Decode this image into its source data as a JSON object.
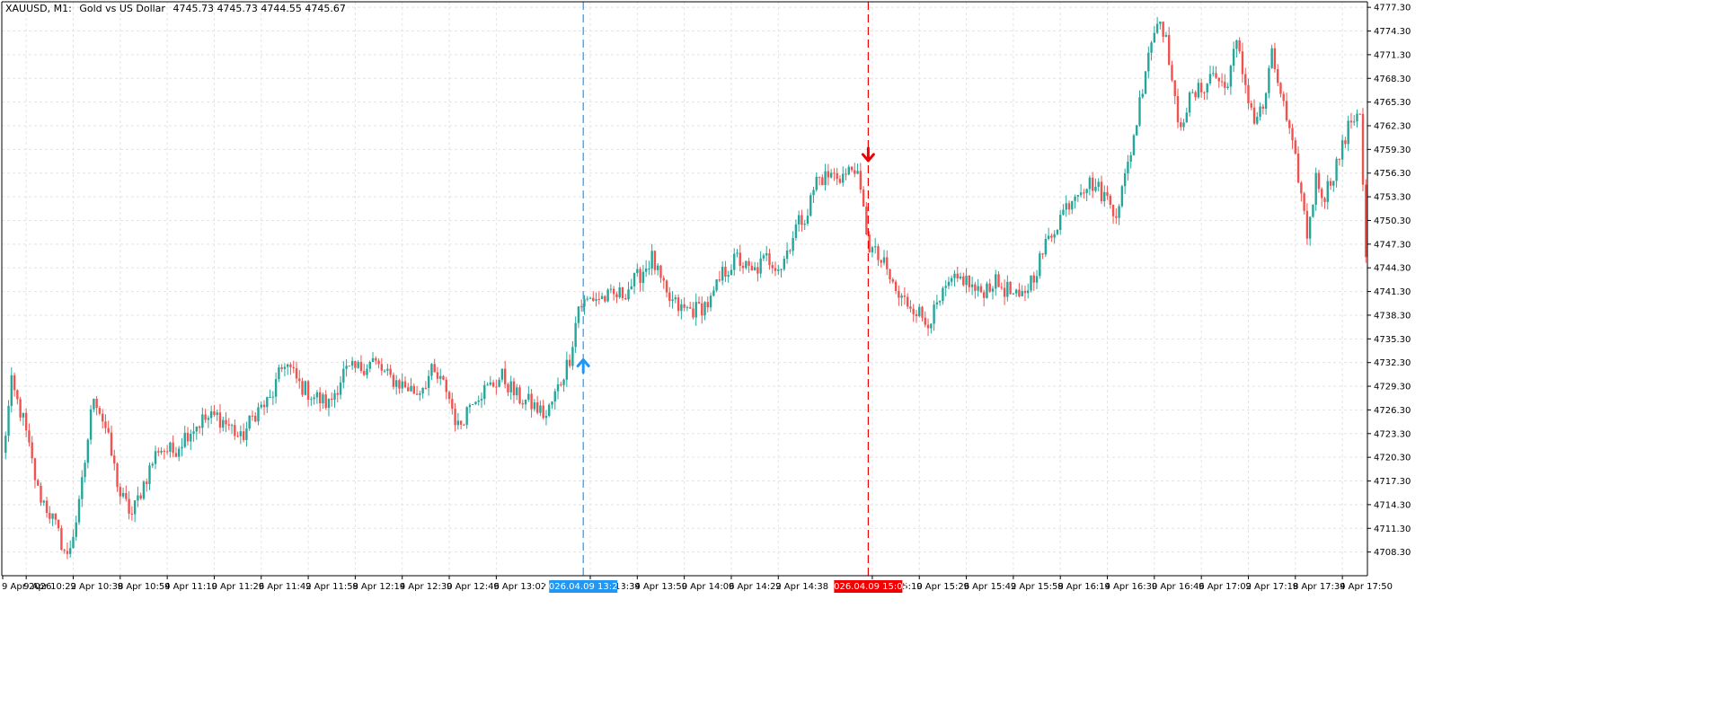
{
  "header": {
    "symbol": "XAUUSD, M1:",
    "description": "Gold vs US Dollar",
    "ohlc": "4745.73 4745.73 4744.55 4745.67"
  },
  "colors": {
    "bull": "#26a69a",
    "bear": "#ef5350",
    "grid": "#e4e4e4",
    "buy_marker": "#2196f3",
    "sell_marker": "#f00000",
    "axis": "#000000"
  },
  "chart_data": {
    "type": "candlestick",
    "timeframe": "M1",
    "ylim": [
      4705.3,
      4778.0
    ],
    "grid": true,
    "y_ticks": [
      "4777.30",
      "4774.30",
      "4771.30",
      "4768.30",
      "4765.30",
      "4762.30",
      "4759.30",
      "4756.30",
      "4753.30",
      "4750.30",
      "4747.30",
      "4744.30",
      "4741.30",
      "4738.30",
      "4735.30",
      "4732.30",
      "4729.30",
      "4726.30",
      "4723.30",
      "4720.30",
      "4717.30",
      "4714.30",
      "4711.30",
      "4708.30"
    ],
    "x_ticks": [
      "9 Apr 2026",
      "9 Apr 10:22",
      "9 Apr 10:38",
      "9 Apr 10:54",
      "9 Apr 11:10",
      "9 Apr 11:26",
      "9 Apr 11:42",
      "9 Apr 11:58",
      "9 Apr 12:14",
      "9 Apr 12:30",
      "9 Apr 12:46",
      "9 Apr 13:02",
      "9 Apr 13:34",
      "9 Apr 13:50",
      "9 Apr 14:06",
      "9 Apr 14:22",
      "9 Apr 14:38",
      "9 Apr 15:10",
      "9 Apr 15:26",
      "9 Apr 15:42",
      "9 Apr 15:58",
      "9 Apr 16:14",
      "9 Apr 16:30",
      "9 Apr 16:46",
      "9 Apr 17:02",
      "9 Apr 17:18",
      "9 Apr 17:34",
      "9 Apr 17:50"
    ],
    "price_path": [
      [
        0,
        4720.5
      ],
      [
        3,
        4729.5
      ],
      [
        7,
        4725.0
      ],
      [
        12,
        4716.0
      ],
      [
        17,
        4712.5
      ],
      [
        22,
        4707.5
      ],
      [
        26,
        4714.0
      ],
      [
        31,
        4728.5
      ],
      [
        35,
        4724.0
      ],
      [
        40,
        4715.5
      ],
      [
        44,
        4713.0
      ],
      [
        48,
        4717.0
      ],
      [
        53,
        4721.5
      ],
      [
        58,
        4721.0
      ],
      [
        63,
        4723.5
      ],
      [
        68,
        4725.0
      ],
      [
        73,
        4725.5
      ],
      [
        78,
        4724.0
      ],
      [
        81,
        4722.5
      ],
      [
        86,
        4726.0
      ],
      [
        91,
        4727.5
      ],
      [
        96,
        4732.5
      ],
      [
        101,
        4729.5
      ],
      [
        106,
        4728.0
      ],
      [
        111,
        4727.0
      ],
      [
        116,
        4731.0
      ],
      [
        121,
        4731.5
      ],
      [
        126,
        4732.5
      ],
      [
        131,
        4730.5
      ],
      [
        136,
        4729.5
      ],
      [
        141,
        4728.5
      ],
      [
        146,
        4731.0
      ],
      [
        151,
        4729.0
      ],
      [
        155,
        4724.0
      ],
      [
        160,
        4728.0
      ],
      [
        165,
        4729.0
      ],
      [
        170,
        4730.5
      ],
      [
        175,
        4728.0
      ],
      [
        180,
        4727.0
      ],
      [
        185,
        4725.5
      ],
      [
        190,
        4730.0
      ],
      [
        193,
        4733.0
      ],
      [
        196,
        4739.5
      ],
      [
        201,
        4740.5
      ],
      [
        206,
        4740.5
      ],
      [
        211,
        4741.0
      ],
      [
        216,
        4743.0
      ],
      [
        221,
        4745.5
      ],
      [
        226,
        4740.5
      ],
      [
        231,
        4739.0
      ],
      [
        236,
        4739.0
      ],
      [
        241,
        4740.0
      ],
      [
        245,
        4743.5
      ],
      [
        250,
        4745.5
      ],
      [
        255,
        4743.5
      ],
      [
        260,
        4745.5
      ],
      [
        265,
        4744.5
      ],
      [
        270,
        4749.5
      ],
      [
        274,
        4751.5
      ],
      [
        277,
        4755.5
      ],
      [
        282,
        4756.0
      ],
      [
        287,
        4756.0
      ],
      [
        290,
        4757.3
      ],
      [
        292,
        4753.5
      ],
      [
        295,
        4747.0
      ],
      [
        300,
        4744.5
      ],
      [
        305,
        4740.5
      ],
      [
        310,
        4739.5
      ],
      [
        314,
        4737.5
      ],
      [
        317,
        4738.5
      ],
      [
        322,
        4742.0
      ],
      [
        327,
        4743.0
      ],
      [
        332,
        4741.0
      ],
      [
        337,
        4742.5
      ],
      [
        342,
        4741.5
      ],
      [
        346,
        4740.0
      ],
      [
        351,
        4743.5
      ],
      [
        356,
        4748.0
      ],
      [
        361,
        4751.5
      ],
      [
        366,
        4754.5
      ],
      [
        371,
        4755.0
      ],
      [
        376,
        4753.0
      ],
      [
        379,
        4751.5
      ],
      [
        382,
        4755.5
      ],
      [
        386,
        4763.0
      ],
      [
        390,
        4772.0
      ],
      [
        394,
        4776.5
      ],
      [
        397,
        4771.0
      ],
      [
        400,
        4762.0
      ],
      [
        404,
        4765.5
      ],
      [
        408,
        4767.0
      ],
      [
        412,
        4769.0
      ],
      [
        416,
        4767.0
      ],
      [
        420,
        4772.5
      ],
      [
        423,
        4767.5
      ],
      [
        426,
        4763.0
      ],
      [
        429,
        4764.5
      ],
      [
        432,
        4771.0
      ],
      [
        435,
        4766.5
      ],
      [
        438,
        4761.0
      ],
      [
        441,
        4756.0
      ],
      [
        444,
        4748.5
      ],
      [
        447,
        4755.5
      ],
      [
        450,
        4753.5
      ],
      [
        453,
        4756.5
      ],
      [
        456,
        4759.5
      ],
      [
        459,
        4763.0
      ],
      [
        462,
        4764.5
      ],
      [
        464,
        4745.67
      ]
    ],
    "markers": [
      {
        "type": "buy",
        "label": "2026.04.09 13:24",
        "bar": 197,
        "price": 4733.0
      },
      {
        "type": "sell",
        "label": "2026.04.09 15:01",
        "bar": 294,
        "price": 4757.3
      }
    ]
  }
}
